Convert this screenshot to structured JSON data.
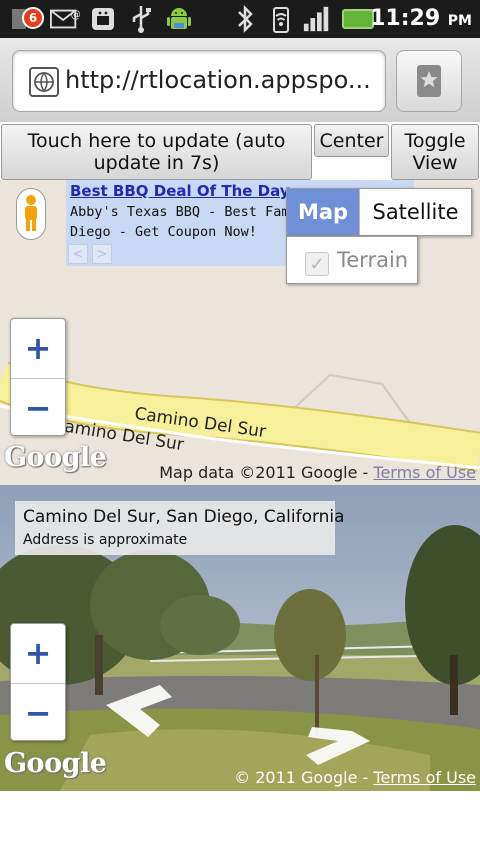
{
  "status_bar": {
    "notification_count": "6",
    "time": "11:29",
    "ampm": "PM",
    "icons": [
      "notification-badge-icon",
      "email-icon",
      "android-debug-icon",
      "usb-icon",
      "android-icon",
      "bluetooth-icon",
      "wifi-icon",
      "signal-icon",
      "battery-icon"
    ]
  },
  "browser": {
    "url": "http://rtlocation.appspo...",
    "bookmark_icon": "star-icon"
  },
  "page_buttons": {
    "update": "Touch here to update (auto update in 7s)",
    "center": "Center",
    "toggle": "Toggle View"
  },
  "map": {
    "ad_title": "Best BBQ Deal Of The Day",
    "ad_line1": "Abby's Texas BBQ - Best Family",
    "ad_line2": "Diego - Get Coupon Now!",
    "ad_prev": "<",
    "ad_next": ">",
    "map_type_map": "Map",
    "map_type_satellite": "Satellite",
    "terrain_label": "Terrain",
    "terrain_check": "✓",
    "zoom_in": "+",
    "zoom_out": "−",
    "road_label_1": "Camino Del Sur",
    "road_label_2": "Camino Del Sur",
    "logo": "Google",
    "copyright_prefix": "Map data ©2011 Google - ",
    "terms": "Terms of Use"
  },
  "street_view": {
    "address": "Camino Del Sur, San Diego, California",
    "address_note": "Address is approximate",
    "zoom_in": "+",
    "zoom_out": "−",
    "logo": "Google",
    "copyright_prefix": "© 2011 Google - ",
    "terms": "Terms of Use"
  },
  "colors": {
    "map_background": "#eae4db",
    "road": "#f7f09a",
    "map_type_selected": "#6f8fd9",
    "ad_background": "#c9d8f3",
    "ad_link": "#1f2ab0",
    "zoom_control": "#2f56a8"
  }
}
